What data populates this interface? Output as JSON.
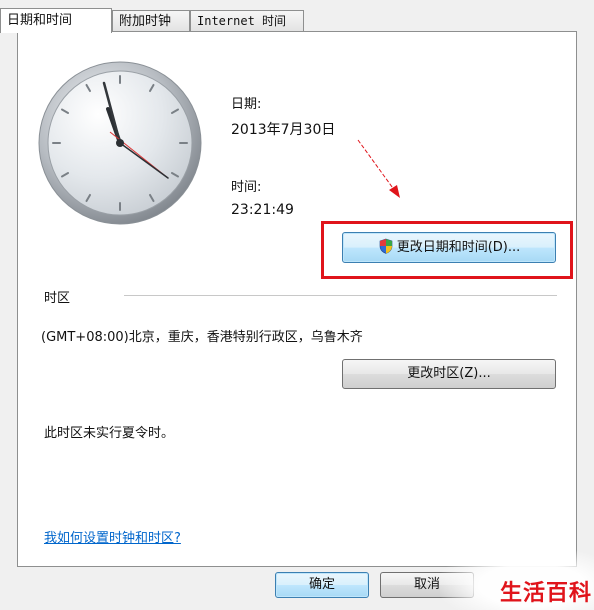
{
  "tabs": [
    {
      "label": "日期和时间",
      "active": true
    },
    {
      "label": "附加时钟",
      "active": false
    },
    {
      "label": "Internet 时间",
      "active": false
    }
  ],
  "date": {
    "label": "日期:",
    "value": "2013年7月30日"
  },
  "time": {
    "label": "时间:",
    "value": "23:21:49"
  },
  "change_datetime_button": "更改日期和时间(D)...",
  "timezone": {
    "section_label": "时区",
    "value": "(GMT+08:00)北京，重庆，香港特别行政区，乌鲁木齐",
    "change_button": "更改时区(Z)...",
    "dst_note": "此时区未实行夏令时。"
  },
  "help_link": "我如何设置时钟和时区?",
  "footer": {
    "ok_label": "确定",
    "cancel_label": "取消"
  },
  "watermark": "生活百科",
  "colors": {
    "highlight_box": "#e0141b",
    "link": "#0066cc"
  }
}
